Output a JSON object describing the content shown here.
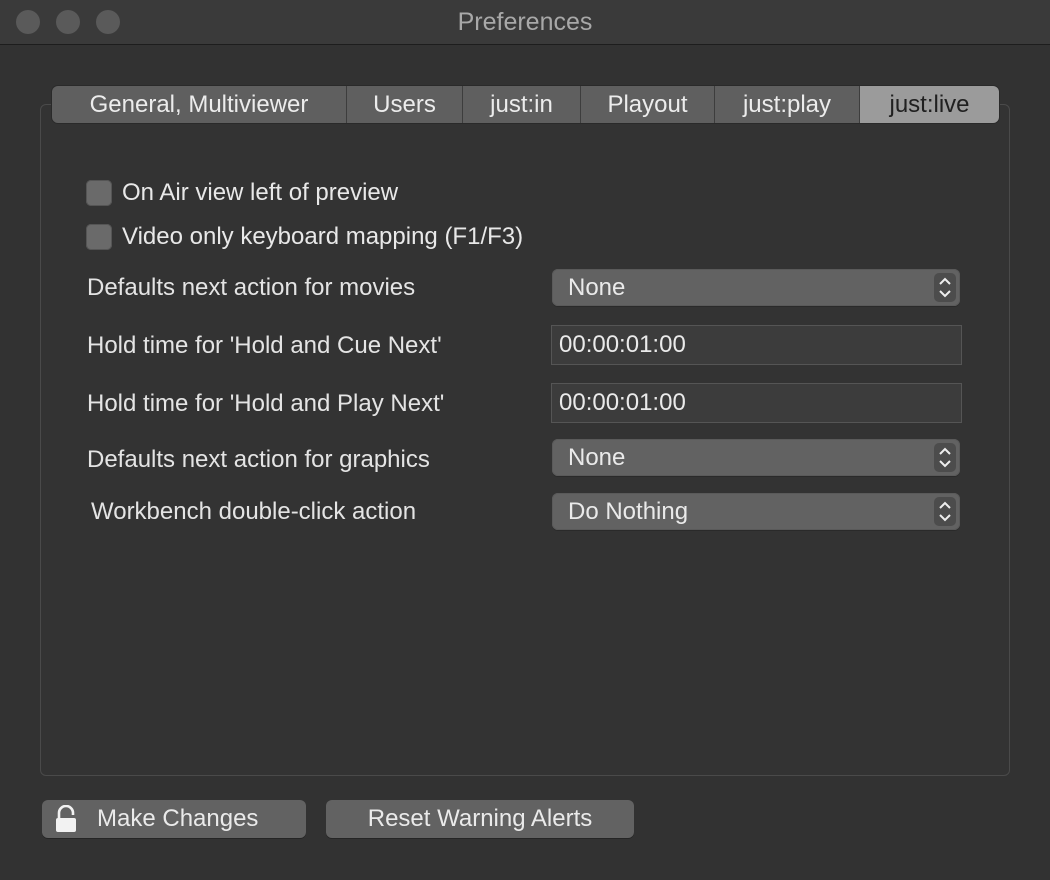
{
  "window": {
    "title": "Preferences"
  },
  "tabs": [
    {
      "label": "General, Multiviewer",
      "active": false
    },
    {
      "label": "Users",
      "active": false
    },
    {
      "label": "just:in",
      "active": false
    },
    {
      "label": "Playout",
      "active": false
    },
    {
      "label": "just:play",
      "active": false
    },
    {
      "label": "just:live",
      "active": true
    }
  ],
  "checkboxes": [
    {
      "label": "On Air view left of preview",
      "checked": false
    },
    {
      "label": "Video only keyboard mapping (F1/F3)",
      "checked": false
    }
  ],
  "settings": {
    "movies_next_action": {
      "label": "Defaults next action for movies",
      "value": "None"
    },
    "hold_cue_next": {
      "label": "Hold time for 'Hold and Cue Next'",
      "value": "00:00:01:00"
    },
    "hold_play_next": {
      "label": "Hold time for 'Hold and Play Next'",
      "value": "00:00:01:00"
    },
    "graphics_next_action": {
      "label": "Defaults next action for graphics",
      "value": "None"
    },
    "workbench_double_click": {
      "label": "Workbench double-click action",
      "value": "Do Nothing"
    }
  },
  "buttons": {
    "make_changes": "Make Changes",
    "reset_warning_alerts": "Reset Warning Alerts"
  },
  "icons": {
    "traffic_lights": [
      "close-icon",
      "minimize-icon",
      "zoom-icon"
    ],
    "popup": "updown-chevron-icon",
    "lock": "lock-icon"
  }
}
